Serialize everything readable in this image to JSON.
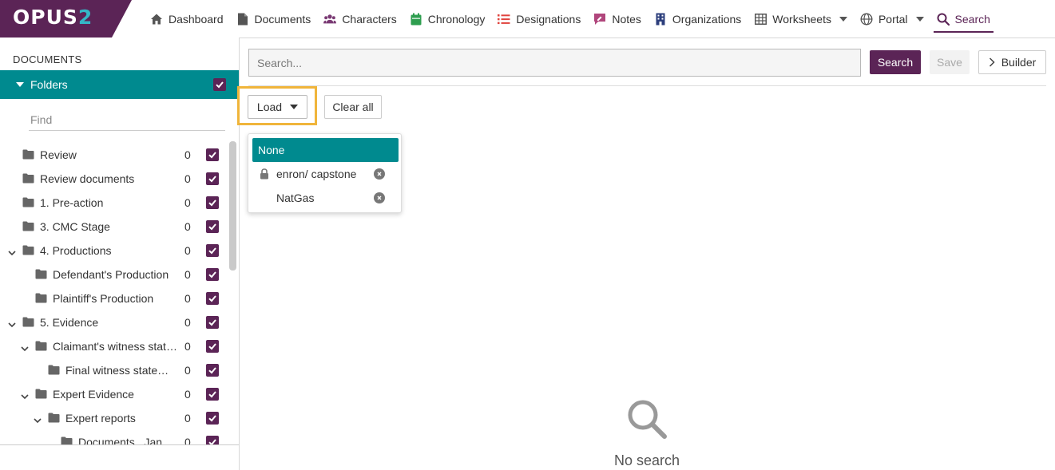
{
  "brand": {
    "logo_main": "OPUS",
    "logo_num": "2",
    "bg_color": "#5b2456",
    "accent_color": "#35b7c6"
  },
  "nav": [
    {
      "label": "Dashboard",
      "icon": "home-icon",
      "active": false,
      "has_caret": false
    },
    {
      "label": "Documents",
      "icon": "document-icon",
      "active": false,
      "has_caret": false
    },
    {
      "label": "Characters",
      "icon": "users-icon",
      "active": false,
      "has_caret": false
    },
    {
      "label": "Chronology",
      "icon": "calendar-icon",
      "active": false,
      "has_caret": false
    },
    {
      "label": "Designations",
      "icon": "list-icon",
      "active": false,
      "has_caret": false
    },
    {
      "label": "Notes",
      "icon": "note-icon",
      "active": false,
      "has_caret": false
    },
    {
      "label": "Organizations",
      "icon": "building-icon",
      "active": false,
      "has_caret": false
    },
    {
      "label": "Worksheets",
      "icon": "table-icon",
      "active": false,
      "has_caret": true
    },
    {
      "label": "Portal",
      "icon": "globe-icon",
      "active": false,
      "has_caret": true
    },
    {
      "label": "Search",
      "icon": "search-icon",
      "active": true,
      "has_caret": false
    }
  ],
  "left_panel": {
    "title": "DOCUMENTS",
    "folders_label": "Folders",
    "find_placeholder": "Find",
    "tree": [
      {
        "name": "Review",
        "count": "0",
        "level": 0,
        "expandable": false
      },
      {
        "name": "Review documents",
        "count": "0",
        "level": 0,
        "expandable": false
      },
      {
        "name": "1. Pre-action",
        "count": "0",
        "level": 0,
        "expandable": false
      },
      {
        "name": "3. CMC Stage",
        "count": "0",
        "level": 0,
        "expandable": false
      },
      {
        "name": "4. Productions",
        "count": "0",
        "level": 0,
        "expandable": true
      },
      {
        "name": "Defendant's Production",
        "count": "0",
        "level": 1,
        "expandable": false
      },
      {
        "name": "Plaintiff's Production",
        "count": "0",
        "level": 1,
        "expandable": false
      },
      {
        "name": "5. Evidence",
        "count": "0",
        "level": 0,
        "expandable": true
      },
      {
        "name": "Claimant's witness statements",
        "count": "0",
        "level": 1,
        "expandable": true
      },
      {
        "name": "Final witness statements",
        "count": "0",
        "level": 2,
        "expandable": false
      },
      {
        "name": "Expert Evidence",
        "count": "0",
        "level": 1,
        "expandable": true
      },
      {
        "name": "Expert reports",
        "count": "0",
        "level": 2,
        "expandable": true
      },
      {
        "name": "Documents...Jan",
        "count": "0",
        "level": 3,
        "expandable": false
      }
    ]
  },
  "main": {
    "search_placeholder": "Search...",
    "search_button": "Search",
    "save_button": "Save",
    "builder_button": "Builder",
    "load_button": "Load",
    "clear_button": "Clear all",
    "load_menu": [
      {
        "label": "None",
        "selected": true,
        "locked": false,
        "removable": false
      },
      {
        "label": "enron/ capstone",
        "selected": false,
        "locked": true,
        "removable": true
      },
      {
        "label": "NatGas",
        "selected": false,
        "locked": false,
        "removable": true
      }
    ],
    "empty_state": "No search"
  },
  "colors": {
    "primary": "#5b2456",
    "teal": "#008a8f",
    "highlight": "#f0b53b"
  }
}
